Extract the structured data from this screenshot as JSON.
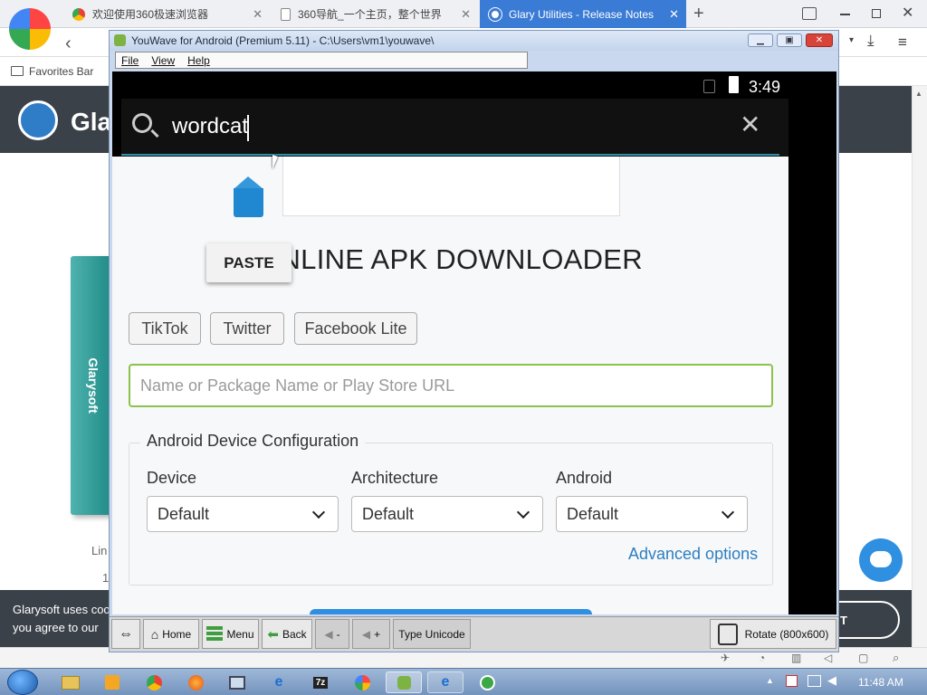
{
  "browser": {
    "tabs": [
      {
        "label": "欢迎使用360极速浏览器",
        "active": false
      },
      {
        "label": "360导航_一个主页，整个世界",
        "active": false
      },
      {
        "label": "Glary Utilities - Release Notes",
        "active": true
      }
    ],
    "new_tab": "+",
    "favorites_bar": "Favorites Bar"
  },
  "website": {
    "logo_text": "Gla",
    "product_box_text": "Glarysoft",
    "partial_text_1": "Lin",
    "partial_text_2": "1",
    "cookie_line_1": "Glarysoft uses coo",
    "cookie_line_2": "you agree to our",
    "cookie_button": "T"
  },
  "youwave": {
    "title": "YouWave for Android (Premium 5.11) - C:\\Users\\vm1\\youwave\\",
    "menu": [
      "File",
      "View",
      "Help"
    ],
    "toolbar": {
      "home": "Home",
      "menu": "Menu",
      "back": "Back",
      "vol_down": "-",
      "vol_up": "+",
      "type_unicode": "Type Unicode",
      "rotate": "Rotate (800x600)"
    }
  },
  "android": {
    "clock": "3:49",
    "search_value": "wordcat",
    "paste_label": "PASTE",
    "page": {
      "heading": "ONLINE APK DOWNLOADER",
      "chips": [
        "TikTok",
        "Twitter",
        "Facebook Lite"
      ],
      "search_placeholder": "Name or Package Name or Play Store URL",
      "config_legend": "Android Device Configuration",
      "device_label": "Device",
      "device_value": "Default",
      "arch_label": "Architecture",
      "arch_value": "Default",
      "android_label": "Android",
      "android_value": "Default",
      "advanced_link": "Advanced options"
    }
  },
  "taskbar": {
    "clock": "11:48 AM",
    "archive_icon_label": "7z"
  },
  "colors": {
    "accent_blue": "#2f8fe0",
    "input_green": "#8bc34a",
    "link_blue": "#2d7fc1",
    "search_underline": "#2e8fa8"
  }
}
